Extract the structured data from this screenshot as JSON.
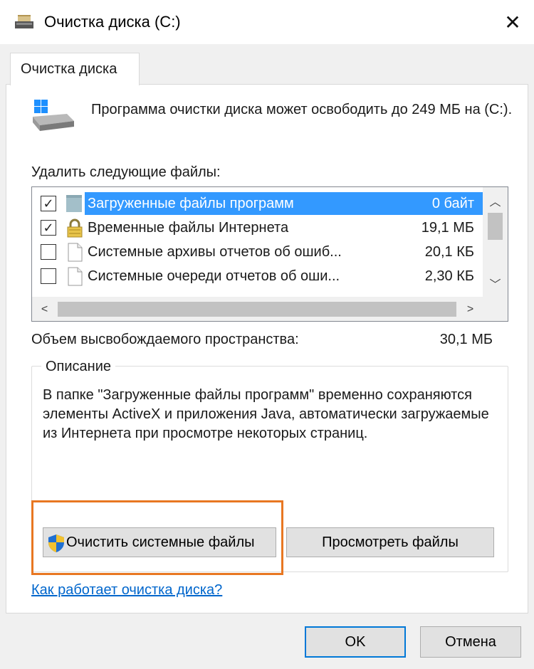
{
  "window": {
    "title": "Очистка диска  (C:)",
    "close_glyph": "✕"
  },
  "tab": {
    "label": "Очистка диска"
  },
  "intro": {
    "text": "Программа очистки диска может освободить до 249 МБ на  (C:)."
  },
  "file_list": {
    "label": "Удалить следующие файлы:",
    "rows": [
      {
        "checked": true,
        "icon": "folder-icon",
        "name": "Загруженные файлы программ",
        "size": "0 байт",
        "selected": true
      },
      {
        "checked": true,
        "icon": "lock-icon",
        "name": "Временные файлы Интернета",
        "size": "19,1 МБ",
        "selected": false
      },
      {
        "checked": false,
        "icon": "document-icon",
        "name": "Системные архивы отчетов об ошиб...",
        "size": "20,1 КБ",
        "selected": false
      },
      {
        "checked": false,
        "icon": "document-icon",
        "name": "Системные очереди отчетов об оши...",
        "size": "2,30 КБ",
        "selected": false
      }
    ]
  },
  "space": {
    "label": "Объем высвобождаемого пространства:",
    "value": "30,1 МБ"
  },
  "description": {
    "title": "Описание",
    "text": "В папке \"Загруженные файлы программ\" временно сохраняются элементы ActiveX и приложения Java, автоматически загружаемые из Интернета при просмотре некоторых страниц."
  },
  "buttons": {
    "cleanup_system": "Очистить системные файлы",
    "view_files": "Просмотреть файлы",
    "ok": "OK",
    "cancel": "Отмена"
  },
  "help_link": "Как работает очистка диска?",
  "colors": {
    "selection": "#3399ff",
    "highlight_frame": "#e87722",
    "link": "#0066cc",
    "focus": "#0078d7"
  }
}
